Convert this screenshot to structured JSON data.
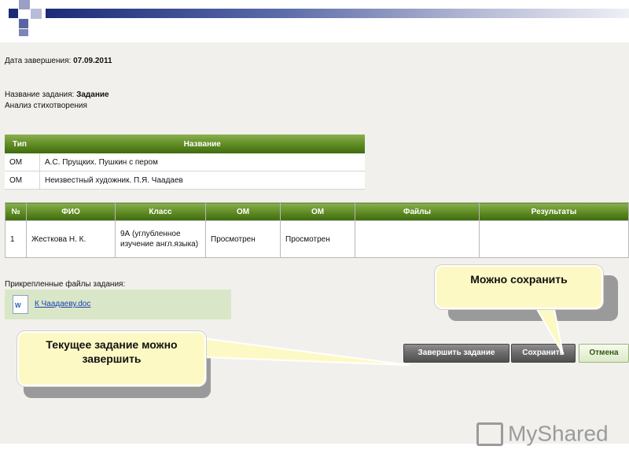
{
  "page": {
    "end_date_label": "Дата завершения:",
    "end_date_value": "07.09.2011",
    "task_name_label": "Название задания:",
    "task_name_value": "Задание",
    "task_desc": "Анализ стихотворения"
  },
  "materials_table": {
    "headers": [
      "Тип",
      "Название"
    ],
    "rows": [
      [
        "ОМ",
        "А.С. Прущких. Пушкин с пером"
      ],
      [
        "ОМ",
        "Неизвестный художник. П.Я. Чаадаев"
      ]
    ]
  },
  "students_table": {
    "headers": [
      "№",
      "ФИО",
      "Класс",
      "ОМ",
      "ОМ",
      "Файлы",
      "Результаты"
    ],
    "rows": [
      [
        "1",
        "Жесткова Н. К.",
        "9А (углубленное изучение англ.языка)",
        "Просмотрен",
        "Просмотрен",
        "",
        ""
      ]
    ]
  },
  "attached": {
    "label": "Прикрепленные файлы задания:",
    "file": "К Чаадаеву.doc"
  },
  "buttons": {
    "finish": "Завершить задание",
    "save": "Сохранить",
    "cancel": "Отмена"
  },
  "callouts": {
    "save_hint": "Можно сохранить",
    "finish_hint": "Текущее задание можно завершить"
  },
  "logo": {
    "text": "MyShared"
  },
  "colors": {
    "header_green": "#5d8a22",
    "callout_fill": "#fdf9c4",
    "content_bg": "#f1f0ec"
  }
}
